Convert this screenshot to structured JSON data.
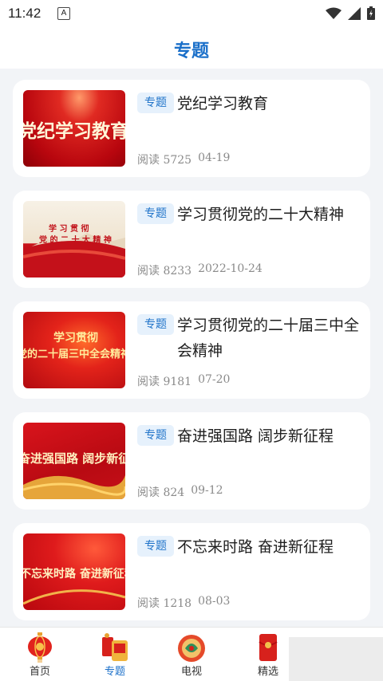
{
  "status_bar": {
    "time": "11:42",
    "notification_letter": "A"
  },
  "header": {
    "title": "专题"
  },
  "articles": [
    {
      "tag": "专题",
      "title": "党纪学习教育",
      "read_label": "阅读",
      "read_count": "5725",
      "date": "04-19",
      "thumb_text": "党纪学习教育"
    },
    {
      "tag": "专题",
      "title": "学习贯彻党的二十大精神",
      "read_label": "阅读",
      "read_count": "8233",
      "date": "2022-10-24",
      "thumb_text_1": "学 习 贯 彻",
      "thumb_text_2": "党 的 二 十 大 精 神"
    },
    {
      "tag": "专题",
      "title": "学习贯彻党的二十届三中全会精神",
      "read_label": "阅读",
      "read_count": "9181",
      "date": "07-20",
      "thumb_text_1": "学习贯彻",
      "thumb_text_2": "党的二十届三中全会精神"
    },
    {
      "tag": "专题",
      "title": "奋进强国路 阔步新征程",
      "read_label": "阅读",
      "read_count": "824",
      "date": "09-12",
      "thumb_text": "奋进强国路 阔步新征程"
    },
    {
      "tag": "专题",
      "title": "不忘来时路 奋进新征程",
      "read_label": "阅读",
      "read_count": "1218",
      "date": "08-03",
      "thumb_text": "不忘来时路 奋进新征程"
    }
  ],
  "bottom_nav": [
    {
      "label": "首页",
      "icon": "lantern-icon"
    },
    {
      "label": "专题",
      "icon": "topic-icon",
      "active": true
    },
    {
      "label": "电视",
      "icon": "tv-icon"
    },
    {
      "label": "精选",
      "icon": "red-envelope-icon"
    }
  ],
  "colors": {
    "accent": "#1a6fc9",
    "tag_bg": "#e6f1fc",
    "thumb_red": "#c8141b"
  }
}
